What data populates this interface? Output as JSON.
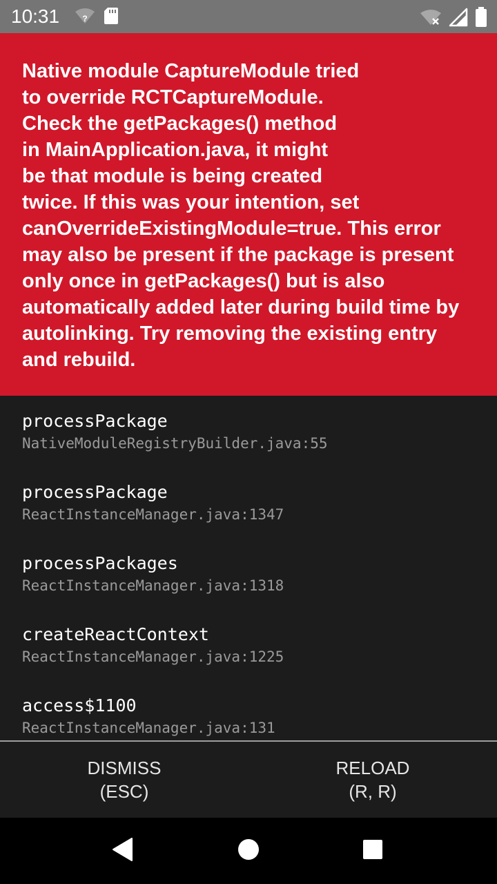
{
  "status_bar": {
    "time": "10:31",
    "left_icons": [
      "wifi-question-icon",
      "sd-card-icon"
    ],
    "right_icons": [
      "wifi-off-icon",
      "signal-icon",
      "battery-icon"
    ]
  },
  "error": {
    "message": "Native module CaptureModule tried\nto override RCTCaptureModule.\nCheck the getPackages() method\nin MainApplication.java, it might\nbe that module is being created\ntwice. If this was your intention, set\ncanOverrideExistingModule=true. This error\nmay also be present if the package is present\nonly once in getPackages() but is also\nautomatically added later during build time by\nautolinking. Try removing the existing entry\nand rebuild."
  },
  "stack_frames": [
    {
      "method": "processPackage",
      "location": "NativeModuleRegistryBuilder.java:55"
    },
    {
      "method": "processPackage",
      "location": "ReactInstanceManager.java:1347"
    },
    {
      "method": "processPackages",
      "location": "ReactInstanceManager.java:1318"
    },
    {
      "method": "createReactContext",
      "location": "ReactInstanceManager.java:1225"
    },
    {
      "method": "access$1100",
      "location": "ReactInstanceManager.java:131"
    }
  ],
  "buttons": {
    "dismiss": "DISMISS\n(ESC)",
    "reload": "RELOAD\n(R, R)"
  },
  "nav_bar": {
    "items": [
      "back-icon",
      "home-icon",
      "recents-icon"
    ]
  },
  "colors": {
    "status_bar": "#757575",
    "error_background": "#d0182a",
    "stack_background": "#1c1c1c",
    "nav_background": "#000000"
  }
}
